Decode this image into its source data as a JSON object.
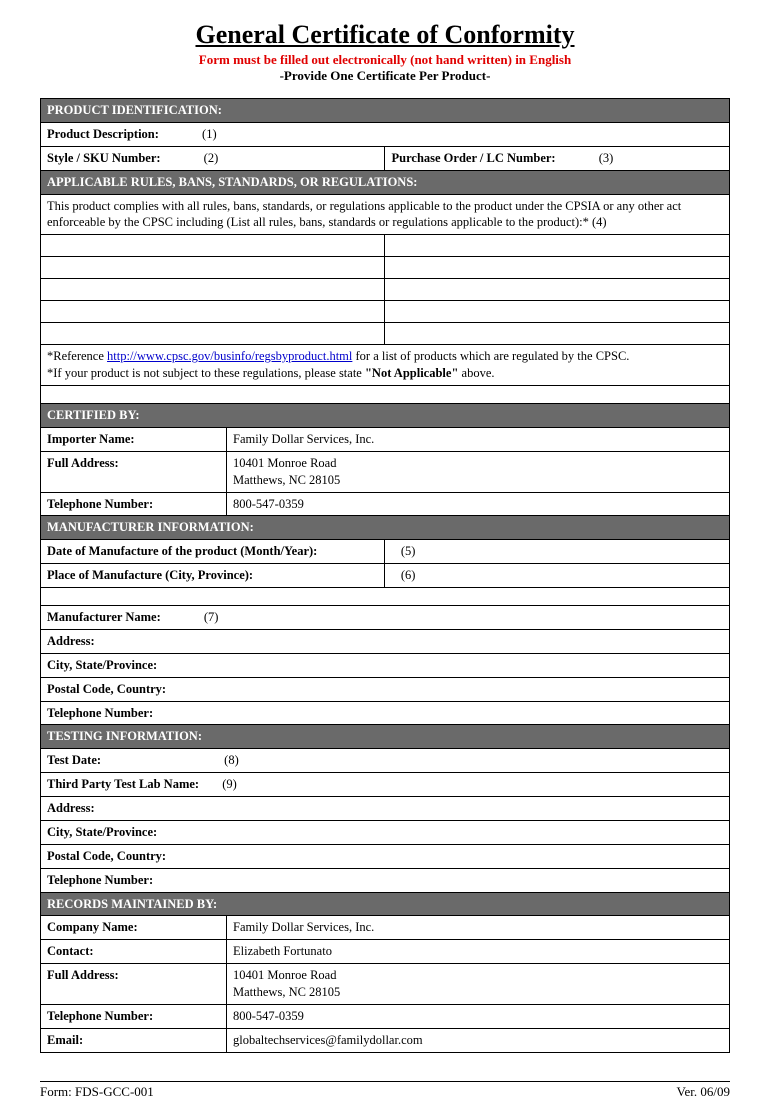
{
  "header": {
    "title": "General Certificate of Conformity",
    "subtitle_red": "Form must be filled out electronically (not hand written) in English",
    "subtitle_black": "-Provide One Certificate Per Product-"
  },
  "sections": {
    "product_id": {
      "header": "PRODUCT IDENTIFICATION:",
      "product_description_label": "Product Description:",
      "product_description_num": "(1)",
      "style_sku_label": "Style / SKU Number:",
      "style_sku_num": "(2)",
      "po_label": "Purchase Order / LC Number:",
      "po_num": "(3)"
    },
    "applicable": {
      "header": "APPLICABLE RULES, BANS, STANDARDS, OR REGULATIONS:",
      "compliance_text": "This product complies with all rules, bans, standards, or regulations applicable to the product under the CPSIA or any other act enforceable by the CPSC including (List all rules, bans, standards or regulations applicable to the product):* (4)",
      "ref_prefix": "*Reference ",
      "ref_link": "http://www.cpsc.gov/businfo/regsbyproduct.html",
      "ref_suffix": " for a list of products which are regulated by the CPSC.",
      "ref_line2_prefix": "*If your product is not subject to these regulations, please state ",
      "ref_line2_bold": "\"Not Applicable\"",
      "ref_line2_suffix": " above."
    },
    "certified_by": {
      "header": "CERTIFIED BY:",
      "importer_label": "Importer Name:",
      "importer_value": "Family Dollar Services, Inc.",
      "address_label": "Full Address:",
      "address_value_1": "10401 Monroe Road",
      "address_value_2": "Matthews, NC 28105",
      "phone_label": "Telephone Number:",
      "phone_value": "800-547-0359"
    },
    "manufacturer": {
      "header": "MANUFACTURER INFORMATION:",
      "date_label": "Date of Manufacture of the product (Month/Year):",
      "date_num": "(5)",
      "place_label": "Place of Manufacture (City, Province):",
      "place_num": "(6)",
      "name_label": "Manufacturer Name:",
      "name_num": "(7)",
      "address_label": "Address:",
      "city_label": "City, State/Province:",
      "postal_label": "Postal Code, Country:",
      "phone_label": "Telephone Number:"
    },
    "testing": {
      "header": "TESTING INFORMATION:",
      "test_date_label": "Test Date:",
      "test_date_num": "(8)",
      "lab_label": "Third Party Test Lab Name:",
      "lab_num": "(9)",
      "address_label": "Address:",
      "city_label": "City, State/Province:",
      "postal_label": "Postal Code, Country:",
      "phone_label": "Telephone Number:"
    },
    "records": {
      "header": "RECORDS MAINTAINED BY:",
      "company_label": "Company Name:",
      "company_value": "Family Dollar Services, Inc.",
      "contact_label": "Contact:",
      "contact_value": "Elizabeth Fortunato",
      "address_label": "Full Address:",
      "address_value_1": "10401 Monroe Road",
      "address_value_2": "Matthews, NC 28105",
      "phone_label": "Telephone Number:",
      "phone_value": "800-547-0359",
      "email_label": "Email:",
      "email_value": "globaltechservices@familydollar.com"
    }
  },
  "footer": {
    "form_id": "Form: FDS-GCC-001",
    "version": "Ver. 06/09"
  }
}
